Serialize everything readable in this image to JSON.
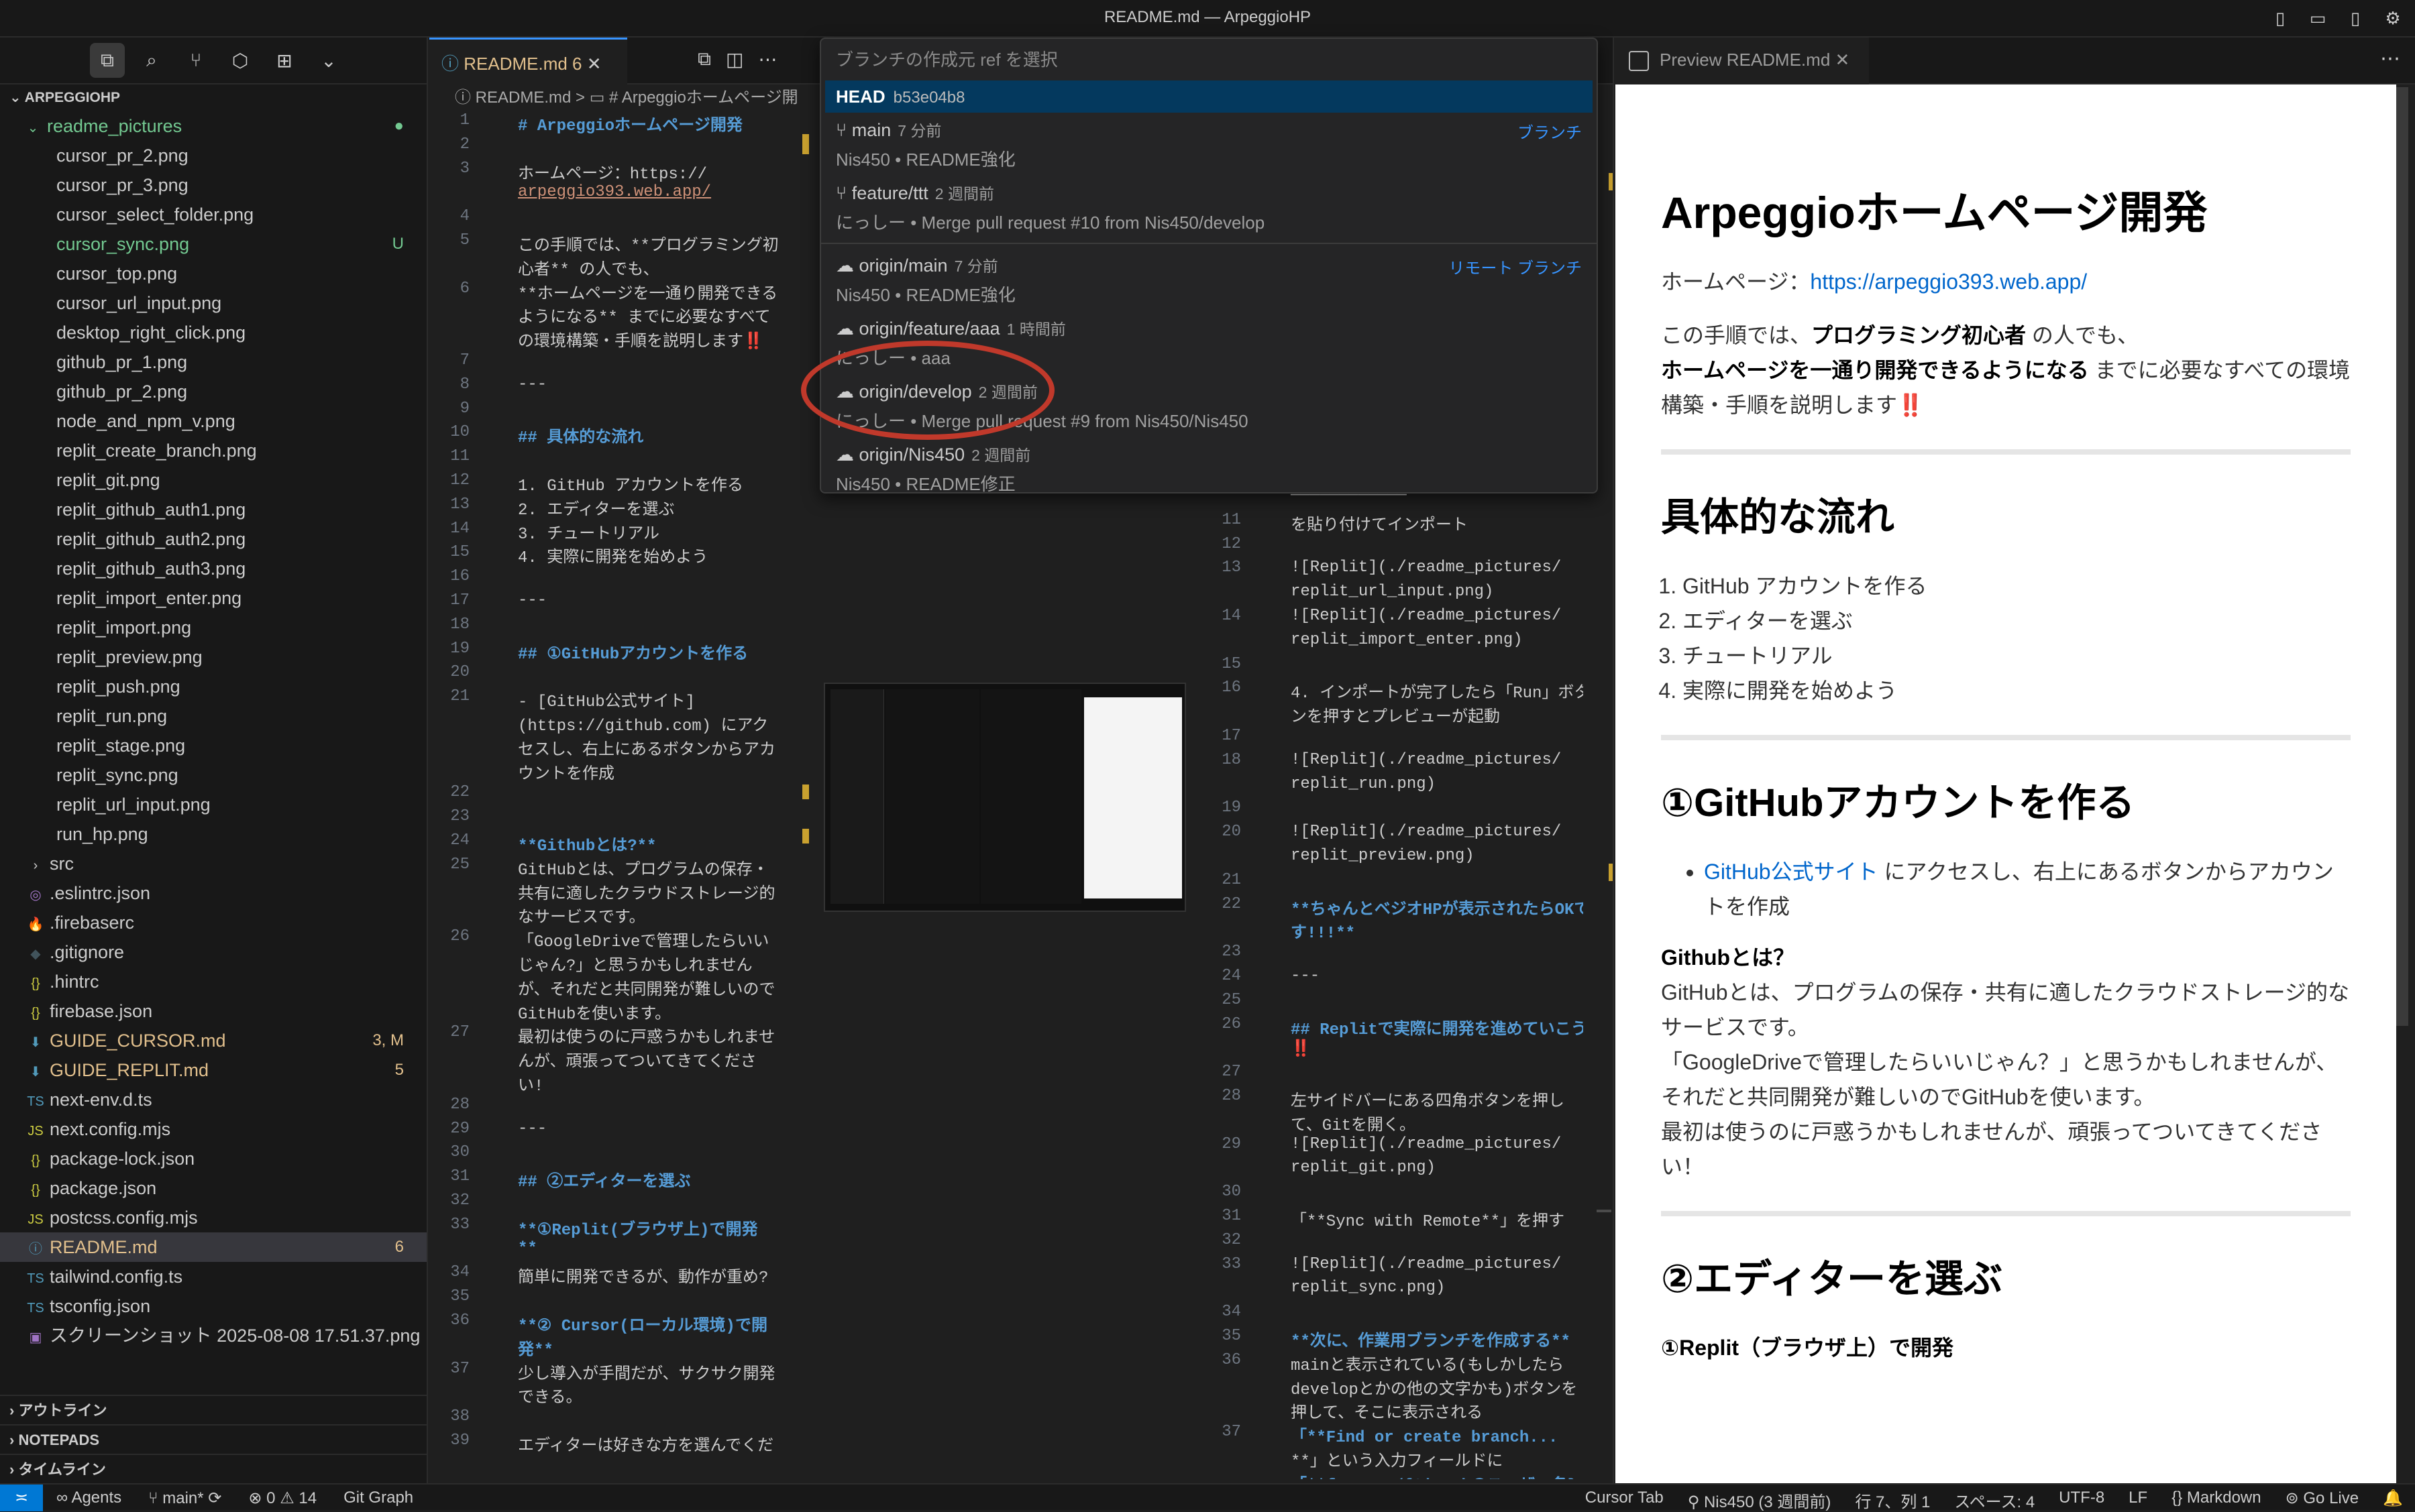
{
  "window": {
    "title": "README.md — ArpeggioHP"
  },
  "explorer": {
    "root": "ARPEGGIOHP",
    "folder": "readme_pictures",
    "files": [
      {
        "name": "cursor_pr_2.png"
      },
      {
        "name": "cursor_pr_3.png"
      },
      {
        "name": "cursor_select_folder.png"
      },
      {
        "name": "cursor_sync.png",
        "badge": "U",
        "color": "#73c991"
      },
      {
        "name": "cursor_top.png"
      },
      {
        "name": "cursor_url_input.png"
      },
      {
        "name": "desktop_right_click.png"
      },
      {
        "name": "github_pr_1.png"
      },
      {
        "name": "github_pr_2.png"
      },
      {
        "name": "node_and_npm_v.png"
      },
      {
        "name": "replit_create_branch.png"
      },
      {
        "name": "replit_git.png"
      },
      {
        "name": "replit_github_auth1.png"
      },
      {
        "name": "replit_github_auth2.png"
      },
      {
        "name": "replit_github_auth3.png"
      },
      {
        "name": "replit_import_enter.png"
      },
      {
        "name": "replit_import.png"
      },
      {
        "name": "replit_preview.png"
      },
      {
        "name": "replit_push.png"
      },
      {
        "name": "replit_run.png"
      },
      {
        "name": "replit_stage.png"
      },
      {
        "name": "replit_sync.png"
      },
      {
        "name": "replit_url_input.png"
      },
      {
        "name": "run_hp.png"
      }
    ],
    "root_items": [
      {
        "name": "src",
        "icon": "›",
        "folder": true
      },
      {
        "name": ".eslintrc.json",
        "icon": "◎",
        "ic": "#a074c4"
      },
      {
        "name": ".firebaserc",
        "icon": "🔥",
        "ic": "#e8a33d"
      },
      {
        "name": ".gitignore",
        "icon": "◆",
        "ic": "#41535b"
      },
      {
        "name": ".hintrc",
        "icon": "{}",
        "ic": "#cbcb41"
      },
      {
        "name": "firebase.json",
        "icon": "{}",
        "ic": "#cbcb41"
      },
      {
        "name": "GUIDE_CURSOR.md",
        "icon": "⬇",
        "ic": "#519aba",
        "badge": "3, M",
        "color": "#e2c08d"
      },
      {
        "name": "GUIDE_REPLIT.md",
        "icon": "⬇",
        "ic": "#519aba",
        "badge": "5",
        "color": "#e2c08d"
      },
      {
        "name": "next-env.d.ts",
        "icon": "TS",
        "ic": "#519aba"
      },
      {
        "name": "next.config.mjs",
        "icon": "JS",
        "ic": "#cbcb41"
      },
      {
        "name": "package-lock.json",
        "icon": "{}",
        "ic": "#cbcb41"
      },
      {
        "name": "package.json",
        "icon": "{}",
        "ic": "#cbcb41"
      },
      {
        "name": "postcss.config.mjs",
        "icon": "JS",
        "ic": "#cbcb41"
      },
      {
        "name": "README.md",
        "icon": "ⓘ",
        "ic": "#519aba",
        "badge": "6",
        "color": "#e2c08d",
        "sel": true
      },
      {
        "name": "tailwind.config.ts",
        "icon": "TS",
        "ic": "#519aba"
      },
      {
        "name": "tsconfig.json",
        "icon": "TS",
        "ic": "#519aba"
      },
      {
        "name": "スクリーンショット 2025-08-08 17.51.37.png",
        "icon": "▣",
        "ic": "#a074c4"
      }
    ],
    "sections": [
      "アウトライン",
      "NOTEPADS",
      "タイムライン"
    ]
  },
  "editor": {
    "tab_label": "README.md 6",
    "breadcrumb": "ⓘ README.md > ▭ # Arpeggioホームページ開",
    "left_code": [
      {
        "n": "1",
        "t": "# Arpeggioホームページ開発",
        "c": "hd"
      },
      {
        "n": "2",
        "t": ""
      },
      {
        "n": "3",
        "t": "ホームページ：https://"
      },
      {
        "n": "",
        "t": "arpeggio393.web.app/",
        "c": "lk"
      },
      {
        "n": "4",
        "t": ""
      },
      {
        "n": "5",
        "t": "この手順では、**プログラミング初"
      },
      {
        "n": "",
        "t": "心者** の人でも、"
      },
      {
        "n": "6",
        "t": "**ホームページを一通り開発できる"
      },
      {
        "n": "",
        "t": "ようになる** までに必要なすべて"
      },
      {
        "n": "",
        "t": "の環境構築・手順を説明します‼️"
      },
      {
        "n": "7",
        "t": ""
      },
      {
        "n": "8",
        "t": "---"
      },
      {
        "n": "9",
        "t": ""
      },
      {
        "n": "10",
        "t": "## 具体的な流れ",
        "c": "hd"
      },
      {
        "n": "11",
        "t": ""
      },
      {
        "n": "12",
        "t": "1. GitHub アカウントを作る"
      },
      {
        "n": "13",
        "t": "2. エディターを選ぶ"
      },
      {
        "n": "14",
        "t": "3. チュートリアル"
      },
      {
        "n": "15",
        "t": "4. 実際に開発を始めよう"
      },
      {
        "n": "16",
        "t": ""
      },
      {
        "n": "17",
        "t": "---"
      },
      {
        "n": "18",
        "t": ""
      },
      {
        "n": "19",
        "t": "## ①GitHubアカウントを作る",
        "c": "hd"
      },
      {
        "n": "20",
        "t": ""
      },
      {
        "n": "21",
        "t": "- [GitHub公式サイト]"
      },
      {
        "n": "",
        "t": "(https://github.com) にアク"
      },
      {
        "n": "",
        "t": "セスし、右上にあるボタンからアカ"
      },
      {
        "n": "",
        "t": "ウントを作成"
      },
      {
        "n": "22",
        "t": ""
      },
      {
        "n": "23",
        "t": ""
      },
      {
        "n": "24",
        "t": "**Githubとは?**",
        "c": "bd"
      },
      {
        "n": "25",
        "t": "GitHubとは、プログラムの保存・"
      },
      {
        "n": "",
        "t": "共有に適したクラウドストレージ的"
      },
      {
        "n": "",
        "t": "なサービスです。"
      },
      {
        "n": "26",
        "t": "「GoogleDriveで管理したらいい"
      },
      {
        "n": "",
        "t": "じゃん?」と思うかもしれません"
      },
      {
        "n": "",
        "t": "が、それだと共同開発が難しいので"
      },
      {
        "n": "",
        "t": "GitHubを使います。"
      },
      {
        "n": "27",
        "t": "最初は使うのに戸惑うかもしれませ"
      },
      {
        "n": "",
        "t": "んが、頑張ってついてきてくださ"
      },
      {
        "n": "",
        "t": "い!"
      },
      {
        "n": "28",
        "t": ""
      },
      {
        "n": "29",
        "t": "---"
      },
      {
        "n": "30",
        "t": ""
      },
      {
        "n": "31",
        "t": "## ②エディターを選ぶ",
        "c": "hd"
      },
      {
        "n": "32",
        "t": ""
      },
      {
        "n": "33",
        "t": "**①Replit(ブラウザ上)で開発",
        "c": "bd"
      },
      {
        "n": "",
        "t": "**",
        "c": "bd"
      },
      {
        "n": "34",
        "t": "簡単に開発できるが、動作が重め?"
      },
      {
        "n": "35",
        "t": ""
      },
      {
        "n": "36",
        "t": "**② Cursor(ローカル環境)で開",
        "c": "bd"
      },
      {
        "n": "",
        "t": "発**",
        "c": "bd"
      },
      {
        "n": "37",
        "t": "少し導入が手間だが、サクサク開発"
      },
      {
        "n": "",
        "t": "できる。"
      },
      {
        "n": "38",
        "t": ""
      },
      {
        "n": "39",
        "t": "エディターは好きな方を選んでくだ"
      }
    ],
    "right_code": [
      {
        "n": "",
        "t": "────────────"
      },
      {
        "n": "11",
        "t": "を貼り付けてインポート"
      },
      {
        "n": "12",
        "t": ""
      },
      {
        "n": "13",
        "t": "![Replit](./readme_pictures/"
      },
      {
        "n": "",
        "t": "replit_url_input.png)"
      },
      {
        "n": "14",
        "t": "![Replit](./readme_pictures/"
      },
      {
        "n": "",
        "t": "replit_import_enter.png)"
      },
      {
        "n": "15",
        "t": ""
      },
      {
        "n": "16",
        "t": "4. インポートが完了したら「Run」ボタ"
      },
      {
        "n": "",
        "t": "ンを押すとプレビューが起動"
      },
      {
        "n": "17",
        "t": ""
      },
      {
        "n": "18",
        "t": "![Replit](./readme_pictures/"
      },
      {
        "n": "",
        "t": "replit_run.png)"
      },
      {
        "n": "19",
        "t": ""
      },
      {
        "n": "20",
        "t": "![Replit](./readme_pictures/"
      },
      {
        "n": "",
        "t": "replit_preview.png)"
      },
      {
        "n": "21",
        "t": ""
      },
      {
        "n": "22",
        "t": "**ちゃんとベジオHPが表示されたらOKで",
        "c": "bd"
      },
      {
        "n": "",
        "t": "す!!!**",
        "c": "bd"
      },
      {
        "n": "23",
        "t": ""
      },
      {
        "n": "24",
        "t": "---"
      },
      {
        "n": "25",
        "t": ""
      },
      {
        "n": "26",
        "t": "## Replitで実際に開発を進めていこう",
        "c": "hd"
      },
      {
        "n": "",
        "t": "‼️"
      },
      {
        "n": "27",
        "t": ""
      },
      {
        "n": "28",
        "t": "左サイドバーにある四角ボタンを押し"
      },
      {
        "n": "",
        "t": "て、Gitを開く。"
      },
      {
        "n": "29",
        "t": "![Replit](./readme_pictures/"
      },
      {
        "n": "",
        "t": "replit_git.png)"
      },
      {
        "n": "30",
        "t": ""
      },
      {
        "n": "31",
        "t": "「**Sync with Remote**」を押す"
      },
      {
        "n": "32",
        "t": ""
      },
      {
        "n": "33",
        "t": "![Replit](./readme_pictures/"
      },
      {
        "n": "",
        "t": "replit_sync.png)"
      },
      {
        "n": "34",
        "t": ""
      },
      {
        "n": "35",
        "t": "**次に、作業用ブランチを作成する**",
        "c": "bd"
      },
      {
        "n": "36",
        "t": "mainと表示されている(もしかしたら"
      },
      {
        "n": "",
        "t": "developとかの他の文字かも)ボタンを"
      },
      {
        "n": "",
        "t": "押して、そこに表示される"
      },
      {
        "n": "37",
        "t": "「**Find or create branch...",
        "c": "bd"
      },
      {
        "n": "",
        "t": "**」という入力フィールドに"
      },
      {
        "n": "",
        "t": "「**feature/{GitHubのユーザー名}",
        "c": "bd"
      }
    ]
  },
  "branch_picker": {
    "placeholder": "ブランチの作成元 ref を選択",
    "head": {
      "label": "HEAD",
      "hash": "b53e04b8"
    },
    "items": [
      {
        "name": "main",
        "time": "7 分前",
        "desc": "Nis450 • README強化",
        "tag": "ブランチ",
        "icon": "⑂"
      },
      {
        "name": "feature/ttt",
        "time": "2 週間前",
        "desc": "にっしー • Merge pull request #10 from Nis450/develop",
        "icon": "⑂"
      },
      {
        "name": "origin/main",
        "time": "7 分前",
        "desc": "Nis450 • README強化",
        "tag": "リモート ブランチ",
        "icon": "☁"
      },
      {
        "name": "origin/feature/aaa",
        "time": "1 時間前",
        "desc": "にっしー • aaa",
        "icon": "☁"
      },
      {
        "name": "origin/develop",
        "time": "2 週間前",
        "desc": "にっしー • Merge pull request #9 from Nis450/Nis450",
        "icon": "☁"
      },
      {
        "name": "origin/Nis450",
        "time": "2 週間前",
        "desc": "Nis450 • README修正",
        "icon": "☁"
      }
    ]
  },
  "preview": {
    "tab_label": "Preview README.md",
    "h1": "Arpeggioホームページ開発",
    "home_label": "ホームページ：",
    "home_url": "https://arpeggio393.web.app/",
    "intro_a": "この手順では、",
    "intro_b": "プログラミング初心者",
    "intro_c": " の人でも、",
    "intro_d": "ホームページを一通り開発できるようになる",
    "intro_e": " までに必要なすべての環境構築・手順を説明します",
    "intro_mark": "‼️",
    "h2_flow": "具体的な流れ",
    "flow": [
      "GitHub アカウントを作る",
      "エディターを選ぶ",
      "チュートリアル",
      "実際に開発を始めよう"
    ],
    "h2_github": "①GitHubアカウントを作る",
    "gh_link": "GitHub公式サイト",
    "gh_text": " にアクセスし、右上にあるボタンからアカウントを作成",
    "gh_what": "Githubとは？",
    "gh_p1": "GitHubとは、プログラムの保存・共有に適したクラウドストレージ的なサービスです。",
    "gh_p2": "「GoogleDriveで管理したらいいじゃん？」と思うかもしれませんが、それだと共同開発が難しいのでGitHubを使います。",
    "gh_p3": "最初は使うのに戸惑うかもしれませんが、頑張ってついてきてください！",
    "h2_editor": "②エディターを選ぶ",
    "editor_sub": "①Replit（ブラウザ上）で開発"
  },
  "status": {
    "agents": "Agents",
    "branch": "main*",
    "errors": "0",
    "warnings": "14",
    "git_graph": "Git Graph",
    "cursor_tab": "Cursor Tab",
    "author": "Nis450 (3 週間前)",
    "position": "行 7、列 1",
    "spaces": "スペース: 4",
    "encoding": "UTF-8",
    "eol": "LF",
    "language": "Markdown",
    "golive": "Go Live"
  }
}
